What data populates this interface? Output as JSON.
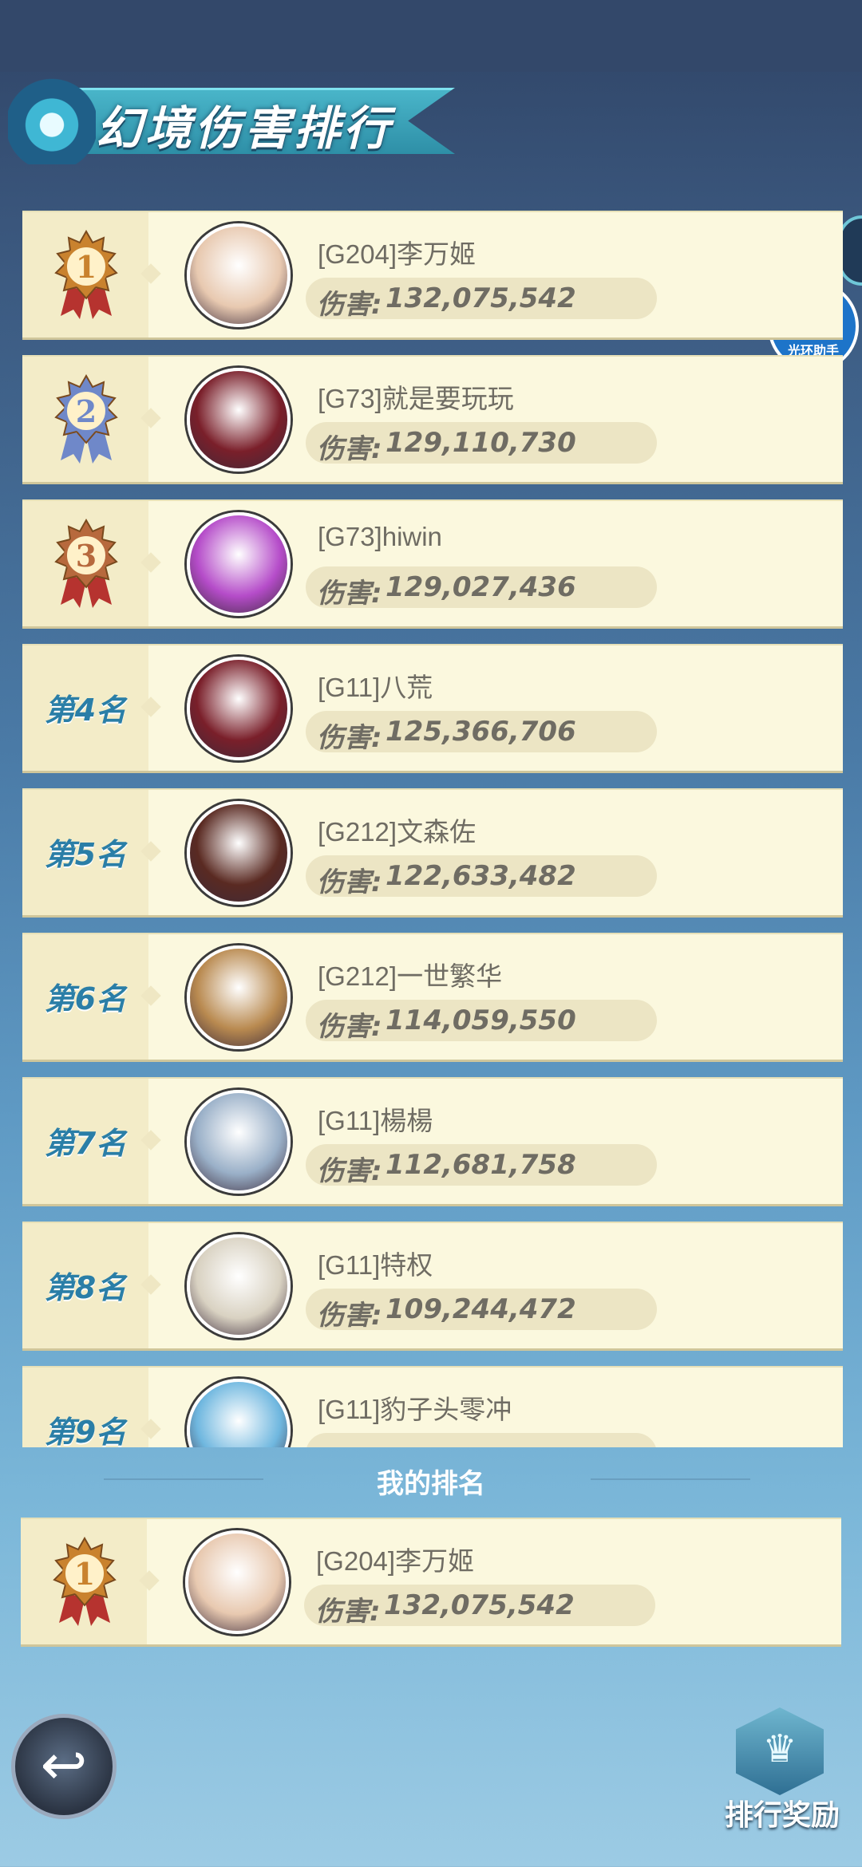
{
  "header": {
    "title": "幻境伤害排行"
  },
  "side_badge": {
    "glyph": "光",
    "label": "光环助手"
  },
  "damage_label": "伤害:",
  "rows": [
    {
      "rank": 1,
      "rank_text": "",
      "medal": "gold",
      "name": "[G204]李万姬",
      "damage": "132,075,542",
      "avatar_color": "#e8c9b0"
    },
    {
      "rank": 2,
      "rank_text": "",
      "medal": "silver",
      "name": "[G73]就是要玩玩",
      "damage": "129,110,730",
      "avatar_color": "#7a1f2a"
    },
    {
      "rank": 3,
      "rank_text": "",
      "medal": "bronze",
      "name": "[G73]hiwin",
      "damage": "129,027,436",
      "avatar_color": "#b54cc9"
    },
    {
      "rank": 4,
      "rank_text": "第4名",
      "medal": "",
      "name": "[G11]八荒",
      "damage": "125,366,706",
      "avatar_color": "#7a1f2a"
    },
    {
      "rank": 5,
      "rank_text": "第5名",
      "medal": "",
      "name": "[G212]文森佐",
      "damage": "122,633,482",
      "avatar_color": "#5a2a22"
    },
    {
      "rank": 6,
      "rank_text": "第6名",
      "medal": "",
      "name": "[G212]一世繁华",
      "damage": "114,059,550",
      "avatar_color": "#b98a50"
    },
    {
      "rank": 7,
      "rank_text": "第7名",
      "medal": "",
      "name": "[G11]楊楊",
      "damage": "112,681,758",
      "avatar_color": "#9ab0c8"
    },
    {
      "rank": 8,
      "rank_text": "第8名",
      "medal": "",
      "name": "[G11]特权",
      "damage": "109,244,472",
      "avatar_color": "#d9d2c2"
    },
    {
      "rank": 9,
      "rank_text": "第9名",
      "medal": "",
      "name": "[G11]豹子头零冲",
      "damage": "",
      "avatar_color": "#6fb7df"
    }
  ],
  "my_rank": {
    "section_title": "我的排名",
    "rank": 1,
    "medal": "gold",
    "name": "[G204]李万姬",
    "damage": "132,075,542",
    "avatar_color": "#e8c9b0"
  },
  "bottom": {
    "back_icon": "back-arrow-icon",
    "reward_label": "排行奖励"
  },
  "colors": {
    "row_bg": "#fbf8de",
    "rank_text": "#2a7ea7",
    "gold": "#c9822e",
    "silver": "#6f88c9",
    "bronze": "#b7693d"
  }
}
